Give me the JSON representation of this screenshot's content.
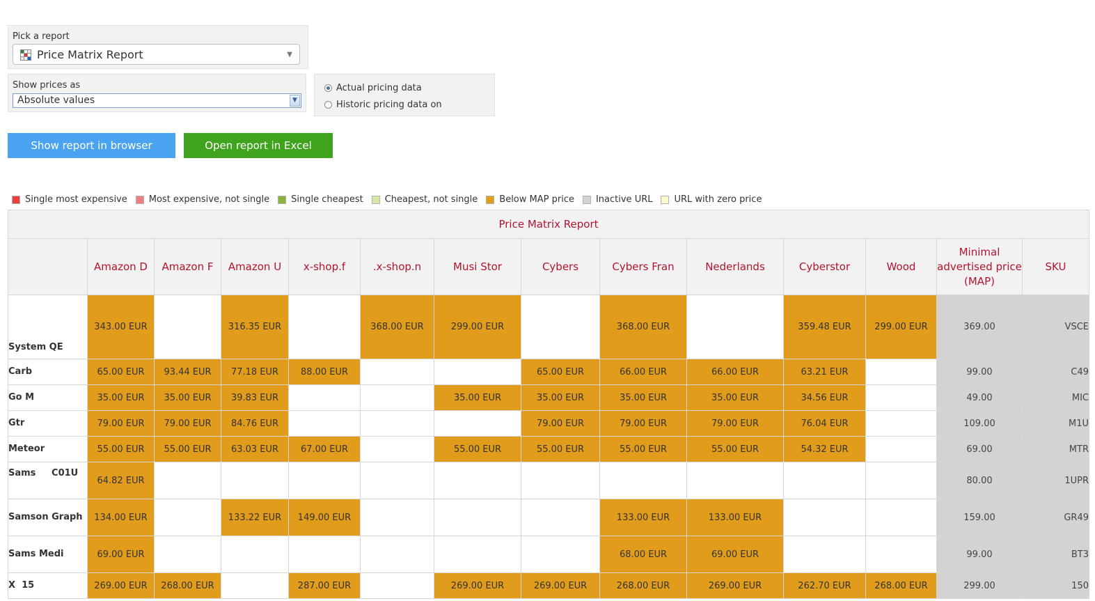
{
  "controls": {
    "report": {
      "label": "Pick a report",
      "value": "Price Matrix Report"
    },
    "show_prices": {
      "label": "Show prices as",
      "value": "Absolute values"
    },
    "pricing_mode": {
      "actual": "Actual pricing data",
      "historic": "Historic pricing data on",
      "selected": "actual"
    },
    "buttons": {
      "browser": "Show report in browser",
      "excel": "Open report in Excel"
    }
  },
  "legend": [
    {
      "label": "Single most expensive",
      "color": "#e8403e"
    },
    {
      "label": "Most expensive, not single",
      "color": "#f08080"
    },
    {
      "label": "Single cheapest",
      "color": "#8db33c"
    },
    {
      "label": "Cheapest, not single",
      "color": "#d4e8a8"
    },
    {
      "label": "Below MAP price",
      "color": "#e29c1c"
    },
    {
      "label": "Inactive URL",
      "color": "#d3d3d3"
    },
    {
      "label": "URL with zero price",
      "color": "#fafac8"
    }
  ],
  "report": {
    "title": "Price Matrix Report",
    "columns": [
      "Amazon D",
      "Amazon F",
      "Amazon U",
      "x-shop.f",
      ".x-shop.n",
      "Musi   Stor",
      "Cybers",
      "Cybers Fran",
      "Nederlands",
      "Cyberstor",
      "Wood",
      "Minimal advertised price (MAP)",
      "SKU"
    ],
    "rows": [
      {
        "product": "System QE",
        "cells": [
          "343.00 EUR",
          "",
          "316.35 EUR",
          "",
          "368.00 EUR",
          "299.00 EUR",
          "",
          "368.00 EUR",
          "",
          "359.48 EUR",
          "299.00 EUR"
        ],
        "map": "369.00",
        "sku": "VSCE"
      },
      {
        "product": "Carb",
        "cells": [
          "65.00 EUR",
          "93.44 EUR",
          "77.18 EUR",
          "88.00 EUR",
          "",
          "",
          "65.00 EUR",
          "66.00 EUR",
          "66.00 EUR",
          "63.21 EUR",
          ""
        ],
        "map": "99.00",
        "sku": "C49"
      },
      {
        "product": "Go M",
        "cells": [
          "35.00 EUR",
          "35.00 EUR",
          "39.83 EUR",
          "",
          "",
          "35.00 EUR",
          "35.00 EUR",
          "35.00 EUR",
          "35.00 EUR",
          "34.56 EUR",
          ""
        ],
        "map": "49.00",
        "sku": "MIC"
      },
      {
        "product": "Gtr",
        "cells": [
          "79.00 EUR",
          "79.00 EUR",
          "84.76 EUR",
          "",
          "",
          "",
          "79.00 EUR",
          "79.00 EUR",
          "79.00 EUR",
          "76.04 EUR",
          ""
        ],
        "map": "109.00",
        "sku": "M1U"
      },
      {
        "product": "Meteor",
        "cells": [
          "55.00 EUR",
          "55.00 EUR",
          "63.03 EUR",
          "67.00 EUR",
          "",
          "55.00 EUR",
          "55.00 EUR",
          "55.00 EUR",
          "55.00 EUR",
          "54.32 EUR",
          ""
        ],
        "map": "69.00",
        "sku": "MTR"
      },
      {
        "product": "Sams     C01U",
        "cells": [
          "64.82 EUR",
          "",
          "",
          "",
          "",
          "",
          "",
          "",
          "",
          "",
          ""
        ],
        "map": "80.00",
        "sku": "1UPR"
      },
      {
        "product": "Samson Graph",
        "cells": [
          "134.00 EUR",
          "",
          "133.22 EUR",
          "149.00 EUR",
          "",
          "",
          "",
          "133.00 EUR",
          "133.00 EUR",
          "",
          ""
        ],
        "map": "159.00",
        "sku": "GR49"
      },
      {
        "product": "Sams Medi",
        "cells": [
          "69.00 EUR",
          "",
          "",
          "",
          "",
          "",
          "",
          "68.00 EUR",
          "69.00 EUR",
          "",
          ""
        ],
        "map": "99.00",
        "sku": "BT3"
      },
      {
        "product": "X  15",
        "cells": [
          "269.00 EUR",
          "268.00 EUR",
          "",
          "287.00 EUR",
          "",
          "269.00 EUR",
          "269.00 EUR",
          "268.00 EUR",
          "269.00 EUR",
          "262.70 EUR",
          "268.00 EUR"
        ],
        "map": "299.00",
        "sku": "150"
      }
    ]
  }
}
